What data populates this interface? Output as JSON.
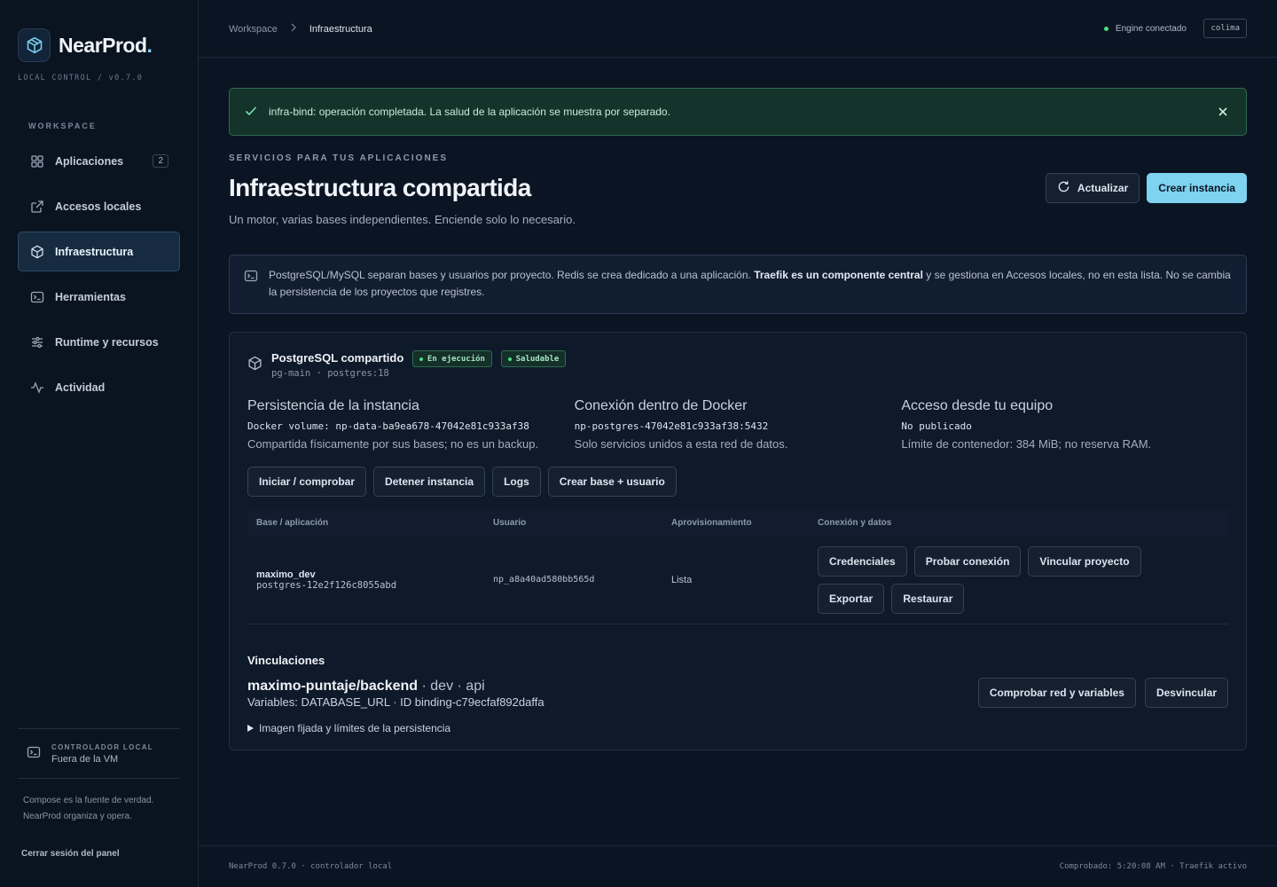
{
  "colors": {
    "accent": "#7dd3f0",
    "success": "#4ade80",
    "background": "#0b1422"
  },
  "brand": {
    "name": "NearProd",
    "dot": ".",
    "subtitle": "LOCAL CONTROL / v0.7.0"
  },
  "sidebar": {
    "heading": "WORKSPACE",
    "items": [
      {
        "label": "Aplicaciones",
        "icon": "grid-icon",
        "count": "2"
      },
      {
        "label": "Accesos locales",
        "icon": "external-link-icon"
      },
      {
        "label": "Infraestructura",
        "icon": "cube-icon",
        "active": true
      },
      {
        "label": "Herramientas",
        "icon": "terminal-icon"
      },
      {
        "label": "Runtime y recursos",
        "icon": "sliders-icon"
      },
      {
        "label": "Actividad",
        "icon": "activity-icon"
      }
    ],
    "controller_label": "CONTROLADOR LOCAL",
    "controller_value": "Fuera de la VM",
    "note": "Compose es la fuente de verdad. NearProd organiza y opera.",
    "logout": "Cerrar sesión del panel"
  },
  "topbar": {
    "breadcrumb": [
      "Workspace",
      "Infraestructura"
    ],
    "engine_status": "Engine conectado",
    "host": "colima"
  },
  "alert": {
    "text": "infra-bind: operación completada. La salud de la aplicación se muestra por separado."
  },
  "page": {
    "eyebrow": "SERVICIOS PARA TUS APLICACIONES",
    "title": "Infraestructura compartida",
    "subtitle": "Un motor, varias bases independientes. Enciende solo lo necesario.",
    "refresh_label": "Actualizar",
    "create_label": "Crear instancia"
  },
  "info": {
    "text_before": "PostgreSQL/MySQL separan bases y usuarios por proyecto. Redis se crea dedicado a una aplicación.",
    "text_bold": "Traefik es un componente central",
    "text_after": "y se gestiona en Accesos locales, no en esta lista. No se cambia la persistencia de los proyectos que registres."
  },
  "service": {
    "name": "PostgreSQL compartido",
    "meta": "pg-main · postgres:18",
    "badges": [
      "En ejecución",
      "Saludable"
    ],
    "columns": [
      {
        "title": "Persistencia de la instancia",
        "code": "Docker volume: np-data-ba9ea678-47042e81c933af38",
        "note": "Compartida físicamente por sus bases; no es un backup."
      },
      {
        "title": "Conexión dentro de Docker",
        "code": "np-postgres-47042e81c933af38:5432",
        "note": "Solo servicios unidos a esta red de datos."
      },
      {
        "title": "Acceso desde tu equipo",
        "code": "No publicado",
        "note": "Límite de contenedor: 384 MiB; no reserva RAM."
      }
    ],
    "actions": [
      "Iniciar / comprobar",
      "Detener instancia",
      "Logs",
      "Crear base + usuario"
    ],
    "table": {
      "headers": [
        "Base / aplicación",
        "Usuario",
        "Aprovisionamiento",
        "Conexión y datos"
      ],
      "rows": [
        {
          "name": "maximo_dev",
          "sub": "postgres-12e2f126c8055abd",
          "user": "np_a8a40ad580bb565d",
          "status": "Lista",
          "actions": [
            "Credenciales",
            "Probar conexión",
            "Vincular proyecto",
            "Exportar",
            "Restaurar"
          ]
        }
      ]
    },
    "bindings_title": "Vinculaciones",
    "binding": {
      "project": "maximo-puntaje/backend",
      "suffix": "· dev · api",
      "vars": "Variables: DATABASE_URL · ID binding-c79ecfaf892daffa",
      "check_label": "Comprobar red y variables",
      "unbind_label": "Desvincular",
      "disclosure": "Imagen fijada y límites de la persistencia"
    }
  },
  "footer": {
    "left": "NearProd 0.7.0 · controlador local",
    "right": "Comprobado: 5:20:08 AM · Traefik activo"
  }
}
